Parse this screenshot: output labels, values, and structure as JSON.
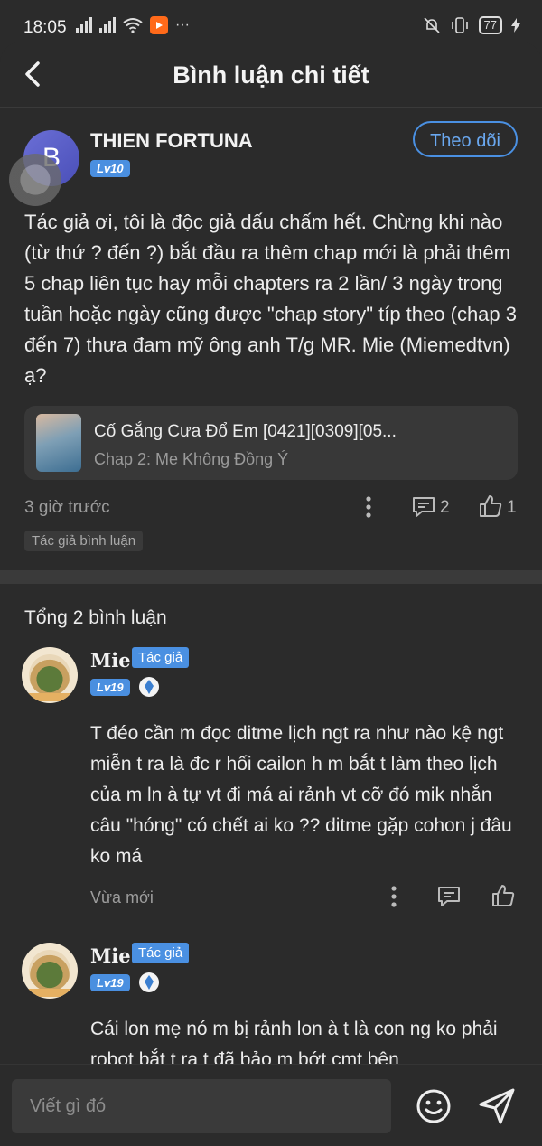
{
  "status_bar": {
    "time": "18:05",
    "battery": "77",
    "more": "···",
    "icons_left": [
      "signal-icon",
      "signal-icon",
      "wifi-icon",
      "play-app-icon",
      "more-dots-icon"
    ],
    "icons_right": [
      "mute-bell-icon",
      "vibrate-icon",
      "battery-icon",
      "charging-icon"
    ]
  },
  "header": {
    "title": "Bình luận chi tiết"
  },
  "comment": {
    "avatar_letter": "B",
    "username": "THIEN FORTUNA",
    "level": "Lv10",
    "follow_label": "Theo dõi",
    "text": "Tác giả ơi, tôi là độc giả dấu chấm hết. Chừng khi nào (từ thứ ? đến ?) bắt đầu ra thêm chap mới là phải thêm 5 chap liên tục hay mỗi chapters ra 2 lần/ 3 ngày trong tuần hoặc ngày cũng được \"chap story\" típ theo (chap 3 đến 7) thưa đam mỹ ông anh T/g MR. Mie (Miemedtvn) ạ?",
    "chapter_card": {
      "title": "Cố Gắng Cưa Đổ Em [0421][0309][05...",
      "subtitle": "Chap 2: Me Không Đồng Ý"
    },
    "time": "3 giờ trước",
    "reply_count": "2",
    "like_count": "1",
    "tag": "Tác giả bình luận"
  },
  "replies_header": "Tổng 2 bình luận",
  "replies": [
    {
      "name": "Mie",
      "badge": "Tác giả",
      "level": "Lv19",
      "text": "T đéo cần m đọc ditme lịch ngt ra như nào kệ ngt miễn t ra là đc r hối cailon h m bắt t làm theo lịch của m ln à tự vt đi má ai rảnh vt cỡ đó mik nhắn câu \"hóng\" có chết ai ko ?? ditme gặp cohon j đâu ko má",
      "time": "Vừa mới"
    },
    {
      "name": "Mie",
      "badge": "Tác giả",
      "level": "Lv19",
      "text": "Cái lon mẹ nó m bị rảnh lon à t là con ng ko phải robot bắt t ra t đã bảo m bớt cmt bên"
    }
  ],
  "composer": {
    "placeholder": "Viết gì đó"
  },
  "colors": {
    "accent": "#4a90e2",
    "background": "#2b2b2b",
    "card": "#383838"
  }
}
